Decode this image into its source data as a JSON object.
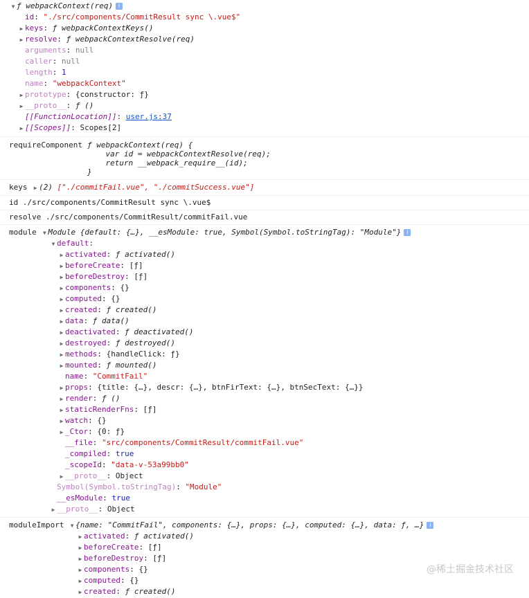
{
  "fn_context": {
    "header": "ƒ webpackContext(req)",
    "rows": [
      {
        "key": "id",
        "sep": ": ",
        "val": "\"./src/components/CommitResult sync \\.vue$\"",
        "cls": "str",
        "indent": 36,
        "arrow": false,
        "keycls": "key-purple"
      },
      {
        "key": "keys",
        "sep": ": ",
        "val": "ƒ webpackContextKeys()",
        "cls": "fn",
        "indent": 26,
        "arrow": true,
        "keycls": "key-purple"
      },
      {
        "key": "resolve",
        "sep": ": ",
        "val": "ƒ webpackContextResolve(req)",
        "cls": "fn",
        "indent": 26,
        "arrow": true,
        "keycls": "key-purple"
      },
      {
        "key": "arguments",
        "sep": ": ",
        "val": "null",
        "cls": "null",
        "indent": 36,
        "arrow": false,
        "keycls": "key-dim"
      },
      {
        "key": "caller",
        "sep": ": ",
        "val": "null",
        "cls": "null",
        "indent": 36,
        "arrow": false,
        "keycls": "key-dim"
      },
      {
        "key": "length",
        "sep": ": ",
        "val": "1",
        "cls": "num",
        "indent": 36,
        "arrow": false,
        "keycls": "key-dim"
      },
      {
        "key": "name",
        "sep": ": ",
        "val": "\"webpackContext\"",
        "cls": "str",
        "indent": 36,
        "arrow": false,
        "keycls": "key-dim"
      },
      {
        "key": "prototype",
        "sep": ": ",
        "val": "{constructor: ƒ}",
        "cls": "",
        "indent": 26,
        "arrow": true,
        "keycls": "key-dim"
      },
      {
        "key": "__proto__",
        "sep": ": ",
        "val": "ƒ ()",
        "cls": "fn",
        "indent": 26,
        "arrow": true,
        "keycls": "key-dim"
      },
      {
        "key": "[[FunctionLocation]]",
        "sep": ": ",
        "val": "user.js:37",
        "cls": "link",
        "indent": 36,
        "arrow": false,
        "keycls": "key-purple it"
      },
      {
        "key": "[[Scopes]]",
        "sep": ": ",
        "val": "Scopes[2]",
        "cls": "",
        "indent": 26,
        "arrow": true,
        "keycls": "key-purple it"
      }
    ]
  },
  "require_component": {
    "label": "requireComponent",
    "code": "ƒ webpackContext(req) {\n    var id = webpackContextResolve(req);\n    return __webpack_require__(id);\n}"
  },
  "keys_line": {
    "label": "keys",
    "count": "(2)",
    "values": "[\"./commitFail.vue\", \"./commitSuccess.vue\"]"
  },
  "id_line": {
    "label": "id",
    "value": "./src/components/CommitResult sync \\.vue$"
  },
  "resolve_line": {
    "label": "resolve",
    "value": "./src/components/CommitResult/commitFail.vue"
  },
  "module": {
    "label": "module",
    "summary": "Module {default: {…}, __esModule: true, Symbol(Symbol.toStringTag): \"Module\"}",
    "default_key": "default:",
    "default_rows": [
      {
        "key": "activated",
        "val": "ƒ activated()",
        "cls": "fn",
        "arrow": true
      },
      {
        "key": "beforeCreate",
        "val": "[ƒ]",
        "cls": "",
        "arrow": true
      },
      {
        "key": "beforeDestroy",
        "val": "[ƒ]",
        "cls": "",
        "arrow": true
      },
      {
        "key": "components",
        "val": "{}",
        "cls": "",
        "arrow": true
      },
      {
        "key": "computed",
        "val": "{}",
        "cls": "",
        "arrow": true
      },
      {
        "key": "created",
        "val": "ƒ created()",
        "cls": "fn",
        "arrow": true
      },
      {
        "key": "data",
        "val": "ƒ data()",
        "cls": "fn",
        "arrow": true
      },
      {
        "key": "deactivated",
        "val": "ƒ deactivated()",
        "cls": "fn",
        "arrow": true
      },
      {
        "key": "destroyed",
        "val": "ƒ destroyed()",
        "cls": "fn",
        "arrow": true
      },
      {
        "key": "methods",
        "val": "{handleClick: ƒ}",
        "cls": "",
        "arrow": true
      },
      {
        "key": "mounted",
        "val": "ƒ mounted()",
        "cls": "fn",
        "arrow": true
      },
      {
        "key": "name",
        "val": "\"CommitFail\"",
        "cls": "str",
        "arrow": false
      },
      {
        "key": "props",
        "val": "{title: {…}, descr: {…}, btnFirText: {…}, btnSecText: {…}}",
        "cls": "",
        "arrow": true
      },
      {
        "key": "render",
        "val": "ƒ ()",
        "cls": "fn",
        "arrow": true
      },
      {
        "key": "staticRenderFns",
        "val": "[ƒ]",
        "cls": "",
        "arrow": true
      },
      {
        "key": "watch",
        "val": "{}",
        "cls": "",
        "arrow": true
      },
      {
        "key": "_Ctor",
        "val": "{0: ƒ}",
        "cls": "",
        "arrow": true
      },
      {
        "key": "__file",
        "val": "\"src/components/CommitResult/commitFail.vue\"",
        "cls": "str",
        "arrow": false
      },
      {
        "key": "_compiled",
        "val": "true",
        "cls": "kw",
        "arrow": false
      },
      {
        "key": "_scopeId",
        "val": "\"data-v-53a99bb0\"",
        "cls": "str",
        "arrow": false
      },
      {
        "key": "__proto__",
        "val": "Object",
        "cls": "",
        "arrow": true,
        "dim": true
      }
    ],
    "tail_rows": [
      {
        "key": "Symbol(Symbol.toStringTag)",
        "val": "\"Module\"",
        "cls": "str",
        "arrow": false,
        "dim": true
      },
      {
        "key": "__esModule",
        "val": "true",
        "cls": "kw",
        "arrow": false,
        "dim": false
      },
      {
        "key": "__proto__",
        "val": "Object",
        "cls": "",
        "arrow": true,
        "dim": true
      }
    ]
  },
  "module_import": {
    "label": "moduleImport",
    "summary": "{name: \"CommitFail\", components: {…}, props: {…}, computed: {…}, data: ƒ, …}",
    "rows": [
      {
        "key": "activated",
        "val": "ƒ activated()",
        "cls": "fn"
      },
      {
        "key": "beforeCreate",
        "val": "[ƒ]",
        "cls": ""
      },
      {
        "key": "beforeDestroy",
        "val": "[ƒ]",
        "cls": ""
      },
      {
        "key": "components",
        "val": "{}",
        "cls": ""
      },
      {
        "key": "computed",
        "val": "{}",
        "cls": ""
      },
      {
        "key": "created",
        "val": "ƒ created()",
        "cls": "fn"
      }
    ]
  },
  "watermark": "@稀土掘金技术社区",
  "icons": {
    "expand": "triangle-right",
    "collapse": "triangle-down",
    "info": "info-square"
  }
}
